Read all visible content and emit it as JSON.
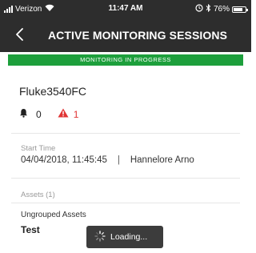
{
  "status_bar": {
    "carrier": "Verizon",
    "time": "11:47 AM",
    "battery": "76%",
    "battery_level": 0.76
  },
  "nav": {
    "title": "ACTIVE MONITORING SESSIONS"
  },
  "banner": {
    "text": "MONITORING IN PROGRESS",
    "color": "#1d9f3c"
  },
  "session": {
    "device_name": "Fluke3540FC",
    "notification_count": "0",
    "alert_count": "1",
    "alert_color": "#e03434",
    "start_time_label": "Start Time",
    "start_time": "04/04/2018, 11:45:45",
    "separator": "|",
    "user": "Hannelore Arno"
  },
  "assets": {
    "label": "Assets (1)",
    "group_label": "Ungrouped Assets",
    "items": [
      "Test"
    ]
  },
  "toast": {
    "text": "Loading..."
  },
  "icons": [
    "signal-icon",
    "wifi-icon",
    "alarm-icon",
    "bluetooth-icon",
    "battery-icon",
    "back-icon",
    "bell-icon",
    "alert-icon",
    "spinner-icon"
  ]
}
